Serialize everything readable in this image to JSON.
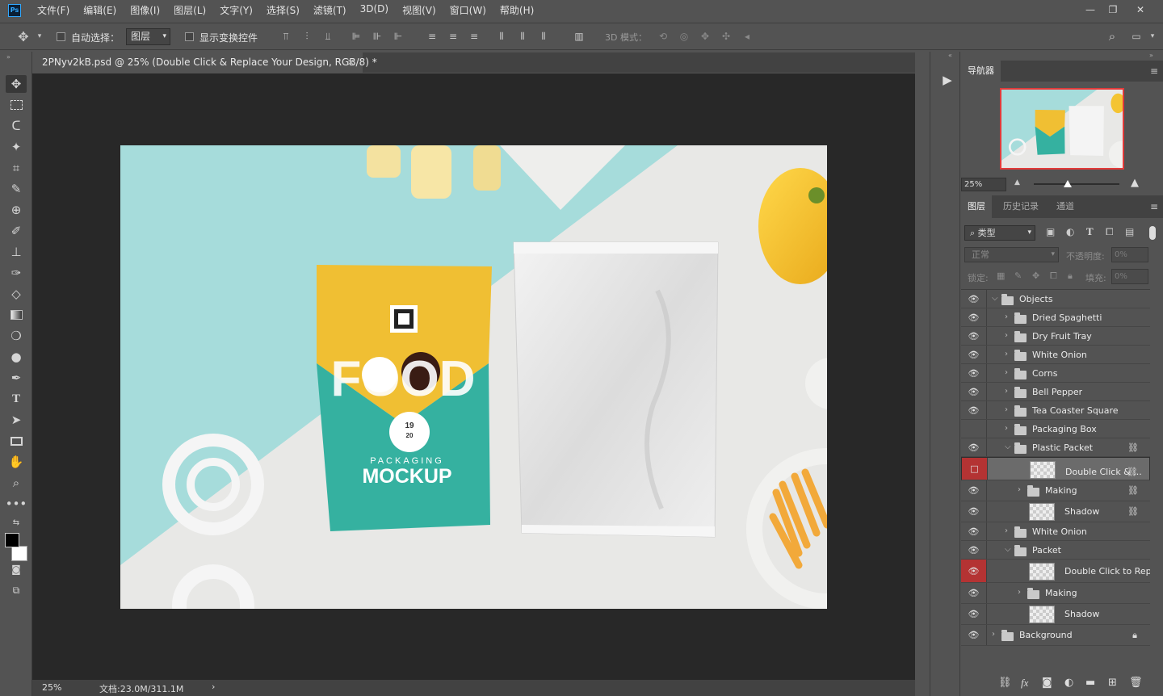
{
  "app": {
    "logo": "Ps"
  },
  "menu": [
    "文件(F)",
    "编辑(E)",
    "图像(I)",
    "图层(L)",
    "文字(Y)",
    "选择(S)",
    "滤镜(T)",
    "3D(D)",
    "视图(V)",
    "窗口(W)",
    "帮助(H)"
  ],
  "window_controls": {
    "minimize": "—",
    "restore": "❐",
    "close": "✕"
  },
  "options": {
    "auto_select_label": "自动选择：",
    "auto_select_value": "图层",
    "show_transform_label": "显示变换控件",
    "mode_3d_label": "3D 模式："
  },
  "document": {
    "tab_title": "2PNyv2kB.psd @ 25% (Double Click & Replace Your Design, RGB/8) *",
    "close": "✕"
  },
  "status": {
    "zoom": "25%",
    "doc_size": "文档:23.0M/311.1M",
    "arrow": "›"
  },
  "navigator": {
    "title": "导航器",
    "zoom": "25%"
  },
  "layers_panel": {
    "tabs": [
      "图层",
      "历史记录",
      "通道"
    ],
    "filter_kind": "类型",
    "blend_mode": "正常",
    "opacity_label": "不透明度:",
    "opacity_value": "0%",
    "lock_label": "锁定:",
    "fill_label": "填充:",
    "fill_value": "0%",
    "layers": [
      {
        "name": "Objects",
        "type": "group",
        "indent": 0,
        "expanded": true,
        "visible": true
      },
      {
        "name": "Dried Spaghetti",
        "type": "group",
        "indent": 1,
        "expanded": false,
        "visible": true
      },
      {
        "name": "Dry Fruit Tray",
        "type": "group",
        "indent": 1,
        "expanded": false,
        "visible": true
      },
      {
        "name": "White Onion",
        "type": "group",
        "indent": 1,
        "expanded": false,
        "visible": true
      },
      {
        "name": "Corns",
        "type": "group",
        "indent": 1,
        "expanded": false,
        "visible": true
      },
      {
        "name": "Bell Pepper",
        "type": "group",
        "indent": 1,
        "expanded": false,
        "visible": true
      },
      {
        "name": "Tea Coaster Square",
        "type": "group",
        "indent": 1,
        "expanded": false,
        "visible": true
      },
      {
        "name": "Packaging Box",
        "type": "group",
        "indent": 1,
        "expanded": false,
        "visible": false
      },
      {
        "name": "Plastic Packet",
        "type": "group",
        "indent": 1,
        "expanded": true,
        "visible": true,
        "linked": true
      },
      {
        "name": "Double Click & ...",
        "type": "smart",
        "indent": 2,
        "visible": false,
        "red": true,
        "selected": true,
        "linked": true
      },
      {
        "name": "Making",
        "type": "group",
        "indent": 2,
        "expanded": false,
        "visible": true,
        "linked": true
      },
      {
        "name": "Shadow",
        "type": "layer",
        "indent": 2,
        "visible": true,
        "linked": true
      },
      {
        "name": "White Onion",
        "type": "group",
        "indent": 1,
        "expanded": false,
        "visible": true
      },
      {
        "name": "Packet",
        "type": "group",
        "indent": 1,
        "expanded": true,
        "visible": true
      },
      {
        "name": "Double Click to Repl...",
        "type": "smart",
        "indent": 2,
        "visible": true,
        "red": true
      },
      {
        "name": "Making",
        "type": "group",
        "indent": 2,
        "expanded": false,
        "visible": true
      },
      {
        "name": "Shadow",
        "type": "layer",
        "indent": 2,
        "visible": true
      },
      {
        "name": "Background",
        "type": "group",
        "indent": 0,
        "expanded": false,
        "visible": true,
        "locked": true
      }
    ]
  },
  "mockup": {
    "pouch_title": "FOOD",
    "pouch_sub": "PACKAGING",
    "pouch_main": "MOCKUP",
    "badge_top": "19",
    "badge_bottom": "20",
    "colors": {
      "mint": "#a6dcdb",
      "yellow": "#f0bf33",
      "teal": "#35b1a0",
      "paper": "#e8e8e6"
    }
  }
}
